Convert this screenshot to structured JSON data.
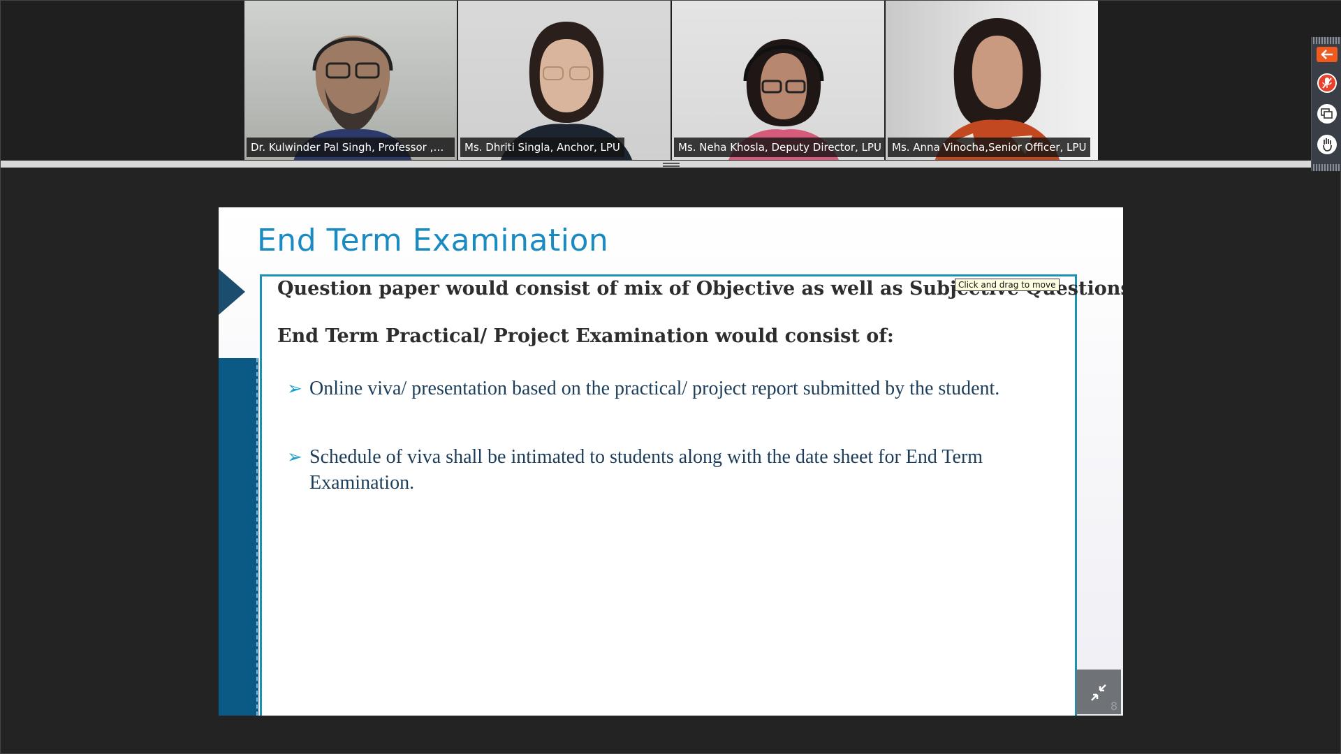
{
  "participants": [
    {
      "name": "Dr. Kulwinder Pal Singh, Professor ,Deput...",
      "active": true
    },
    {
      "name": "Ms. Dhriti Singla, Anchor, LPU",
      "active": false
    },
    {
      "name": "Ms. Neha Khosla, Deputy Director, LPU",
      "active": false
    },
    {
      "name": "Ms. Anna Vinocha,Senior Officer, LPU",
      "active": false
    }
  ],
  "toolbar": {
    "exit_icon": "exit-arrow-icon",
    "mic_icon": "microphone-muted-icon",
    "share_icon": "screen-share-icon",
    "hand_icon": "raise-hand-icon"
  },
  "slide": {
    "title": "End Term Examination",
    "line1": "Question paper would consist of mix of Objective as well as Subjective Questions.",
    "line2": "End Term Practical/ Project Examination would consist of:",
    "bullets": [
      "Online viva/ presentation based on the practical/ project report submitted  by the student.",
      " Schedule of viva shall be intimated to students along with the date sheet for End Term Examination."
    ],
    "bullet_mark": "➢",
    "page_number": "8"
  },
  "tooltip": "Click and drag to move",
  "colors": {
    "title": "#1a8ac2",
    "active_speaker": "#2ebd88",
    "mic_muted": "#e8422c",
    "exit": "#ef5a1e"
  }
}
